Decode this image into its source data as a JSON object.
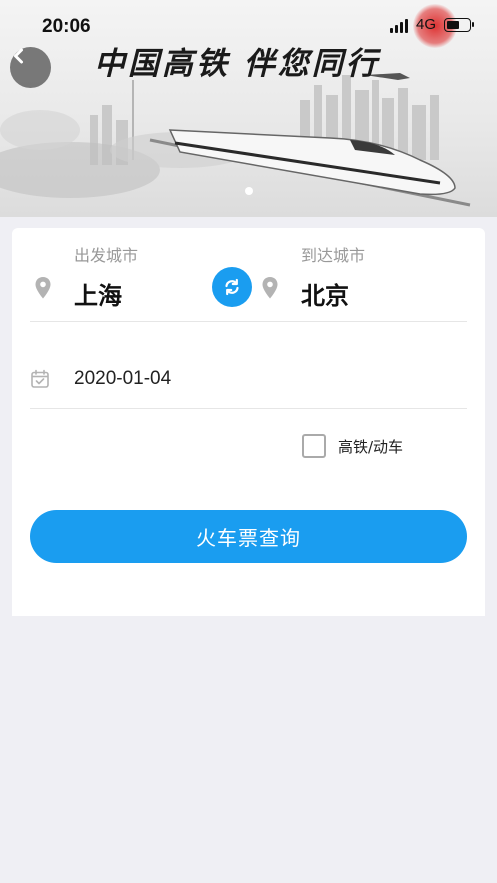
{
  "status_bar": {
    "time": "20:06",
    "network": "4G"
  },
  "banner": {
    "slogan": "中国高铁  伴您同行"
  },
  "form": {
    "departure_label": "出发城市",
    "departure_city": "上海",
    "arrival_label": "到达城市",
    "arrival_city": "北京",
    "date": "2020-01-04",
    "high_speed_label": "高铁/动车",
    "high_speed_checked": false,
    "search_button": "火车票查询"
  },
  "colors": {
    "accent": "#1a9df0",
    "background": "#efeff4"
  },
  "icons": [
    "back-arrow-icon",
    "location-pin-icon",
    "swap-icon",
    "calendar-icon"
  ]
}
